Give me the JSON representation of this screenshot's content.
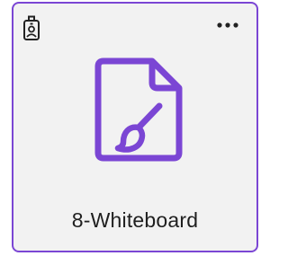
{
  "card": {
    "title": "8-Whiteboard",
    "type_icon": "file-brush-icon",
    "badge_icon": "id-badge-icon",
    "menu_icon": "more-horizontal-icon"
  },
  "colors": {
    "accent": "#7b46d4",
    "card_background": "#f2f2f2",
    "text": "#1f1f1f"
  }
}
